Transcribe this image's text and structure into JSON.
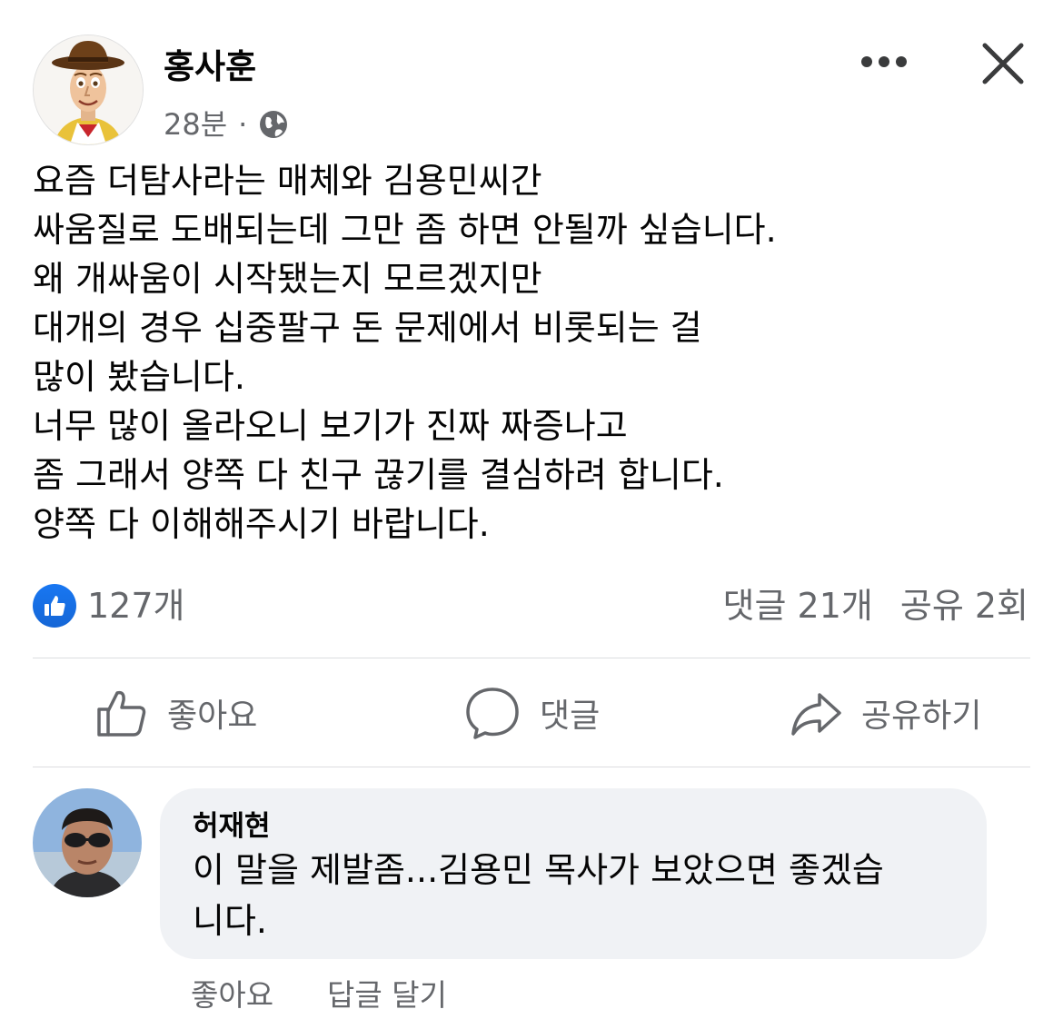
{
  "post": {
    "author": "홍사훈",
    "time": "28분",
    "separator": "·",
    "audience_icon": "globe-icon",
    "lines": [
      "요즘 더탐사라는 매체와 김용민씨간",
      "싸움질로 도배되는데 그만 좀 하면 안될까 싶습니다.",
      "왜 개싸움이 시작됐는지 모르겠지만",
      "대개의 경우 십중팔구 돈 문제에서 비롯되는 걸",
      "많이 봤습니다.",
      "너무 많이 올라오니 보기가 진짜 짜증나고",
      "좀 그래서 양쪽 다 친구 끊기를 결심하려 합니다.",
      "양쪽 다 이해해주시기 바랍니다."
    ]
  },
  "stats": {
    "likes": "127개",
    "comments": "댓글 21개",
    "shares": "공유 2회"
  },
  "actions": {
    "like": "좋아요",
    "comment": "댓글",
    "share": "공유하기"
  },
  "comment": {
    "author": "허재현",
    "line1": "이 말을 제발좀...김용민 목사가 보았으면 좋겠습",
    "line2": "니다.",
    "like": "좋아요",
    "reply": "답글 달기"
  },
  "colors": {
    "like_blue": "#1877f2",
    "secondary_text": "#65676b",
    "bubble_bg": "#f0f2f5",
    "divider": "#dcdde0"
  }
}
